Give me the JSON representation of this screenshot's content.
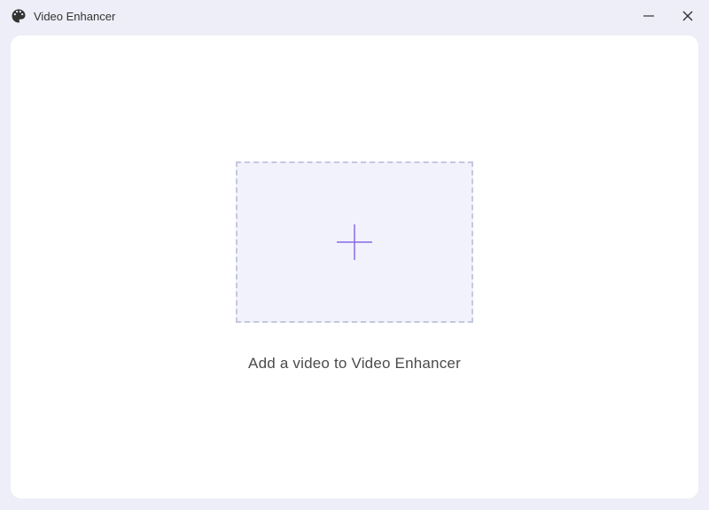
{
  "titlebar": {
    "app_title": "Video Enhancer"
  },
  "main": {
    "instruction": "Add a video to Video Enhancer"
  }
}
